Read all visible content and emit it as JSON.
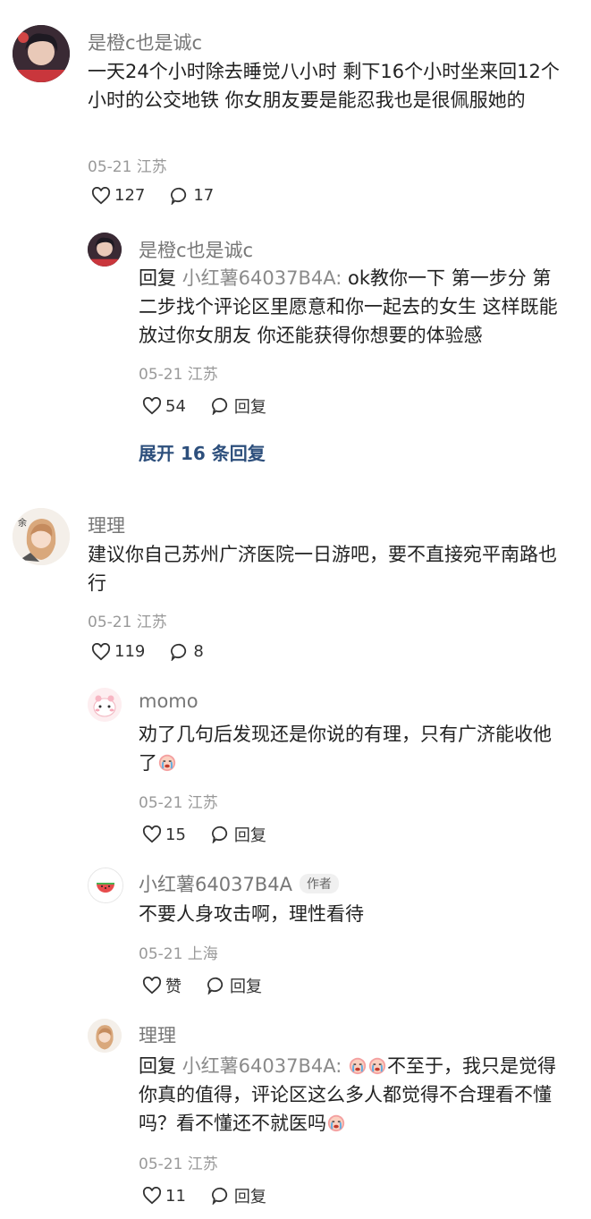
{
  "comments": [
    {
      "name": "是橙c也是诚c",
      "text": "一天24个小时除去睡觉八小时 剩下16个小时坐来回12个小时的公交地铁 你女朋友要是能忍我也是很佩服她的",
      "meta": "05-21 江苏",
      "likes": "127",
      "reply_count": "17",
      "replies": [
        {
          "name": "是橙c也是诚c",
          "reply_prefix": "回复 ",
          "reply_target": "小红薯64037B4A:",
          "text": " ok教你一下 第一步分 第二步找个评论区里愿意和你一起去的女生 这样既能放过你女朋友 你还能获得你想要的体验感",
          "meta": "05-21 江苏",
          "likes": "54",
          "reply_label": "回复"
        }
      ],
      "expand_label": "展开 16 条回复"
    },
    {
      "name": "理理",
      "text": "建议你自己苏州广济医院一日游吧，要不直接宛平南路也行",
      "meta": "05-21 江苏",
      "likes": "119",
      "reply_count": "8",
      "replies": [
        {
          "name": "momo",
          "text": "劝了几句后发现还是你说的有理，只有广济能收他了",
          "meta": "05-21 江苏",
          "likes": "15",
          "reply_label": "回复"
        },
        {
          "name": "小红薯64037B4A",
          "author_tag": "作者",
          "text": "不要人身攻击啊，理性看待",
          "meta": "05-21 上海",
          "likes": "赞",
          "reply_label": "回复"
        },
        {
          "name": "理理",
          "reply_prefix": "回复 ",
          "reply_target": "小红薯64037B4A:",
          "text_a": "不至于，我只是觉得你真的值得，评论区这么多人都觉得不合理看不懂吗？看不懂还不就医吗",
          "meta": "05-21 江苏",
          "likes": "11",
          "reply_label": "回复"
        }
      ]
    }
  ],
  "icons": {
    "like": "heart-outline-icon",
    "comment": "speech-bubble-icon",
    "emoji": "crying-face-emoji"
  },
  "colors": {
    "expand_link": "#2d4f7c",
    "meta_text": "#999999",
    "name_text": "#777777"
  }
}
